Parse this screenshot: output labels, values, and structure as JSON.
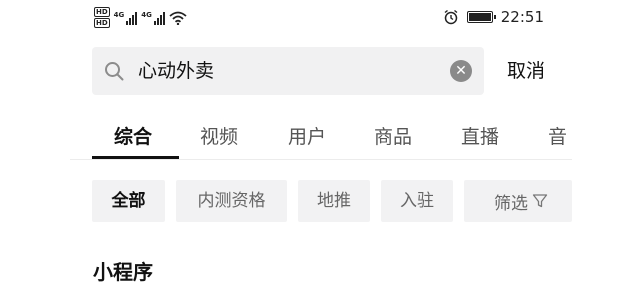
{
  "status_bar": {
    "hd_badges": [
      "HD",
      "HD"
    ],
    "network_labels": [
      "4G",
      "4G"
    ],
    "time": "22:51",
    "icons": [
      "hd-icon",
      "signal-icon",
      "wifi-icon",
      "alarm-icon",
      "battery-icon"
    ]
  },
  "search": {
    "query": "心动外卖",
    "cancel_label": "取消",
    "icons": [
      "search-icon",
      "clear-icon"
    ]
  },
  "tabs": [
    {
      "label": "综合",
      "active": true
    },
    {
      "label": "视频",
      "active": false
    },
    {
      "label": "用户",
      "active": false
    },
    {
      "label": "商品",
      "active": false
    },
    {
      "label": "直播",
      "active": false
    },
    {
      "label": "音",
      "active": false
    }
  ],
  "filters": {
    "chips": [
      {
        "label": "全部",
        "active": true
      },
      {
        "label": "内测资格",
        "active": false
      },
      {
        "label": "地推",
        "active": false
      },
      {
        "label": "入驻",
        "active": false
      }
    ],
    "filter_label": "筛选",
    "filter_icon": "funnel-icon"
  },
  "section": {
    "title": "小程序"
  },
  "colors": {
    "search_bg": "#f1f1f2",
    "chip_bg": "#f2f2f3",
    "active_text": "#111111",
    "inactive_text": "#555555"
  }
}
